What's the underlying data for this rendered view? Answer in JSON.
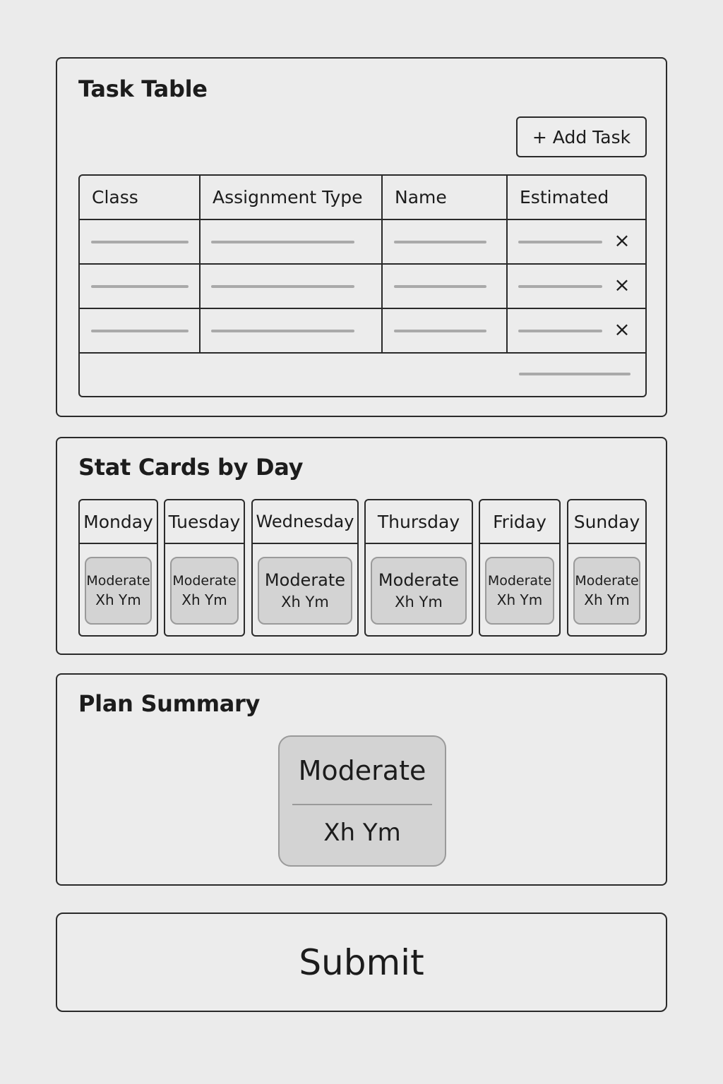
{
  "task_table": {
    "title": "Task Table",
    "add_button_label": "+ Add Task",
    "columns": [
      "Class",
      "Assignment Type",
      "Name",
      "Estimated"
    ],
    "delete_icon": "close-icon",
    "delete_glyph": "×"
  },
  "stat_cards": {
    "title": "Stat Cards by Day",
    "days": [
      {
        "day": "Monday",
        "level": "Moderate",
        "time": "Xh Ym"
      },
      {
        "day": "Tuesday",
        "level": "Moderate",
        "time": "Xh Ym"
      },
      {
        "day": "Wednesday",
        "level": "Moderate",
        "time": "Xh Ym"
      },
      {
        "day": "Thursday",
        "level": "Moderate",
        "time": "Xh Ym"
      },
      {
        "day": "Friday",
        "level": "Moderate",
        "time": "Xh Ym"
      },
      {
        "day": "Sunday",
        "level": "Moderate",
        "time": "Xh Ym"
      }
    ]
  },
  "plan_summary": {
    "title": "Plan Summary",
    "level": "Moderate",
    "time": "Xh Ym"
  },
  "submit_label": "Submit"
}
